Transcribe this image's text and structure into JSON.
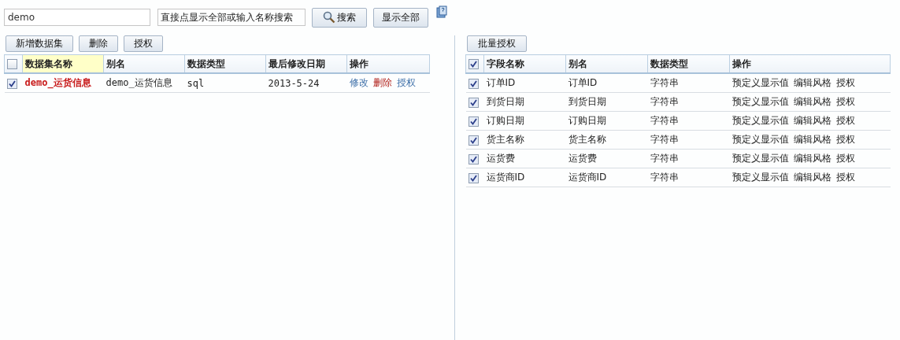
{
  "search": {
    "value": "demo"
  },
  "hint": "直接点显示全部或输入名称搜索",
  "search_button": "搜索",
  "show_all_button": "显示全部",
  "left": {
    "buttons": [
      "新增数据集",
      "删除",
      "授权"
    ],
    "header_checked": false,
    "columns": [
      {
        "label": "数据集名称",
        "highlighted": true
      },
      {
        "label": "别名",
        "highlighted": false
      },
      {
        "label": "数据类型",
        "highlighted": false
      },
      {
        "label": "最后修改日期",
        "highlighted": false
      },
      {
        "label": "操作",
        "highlighted": false
      }
    ],
    "rows": [
      {
        "checked": true,
        "name": "demo_运货信息",
        "alias": "demo_运货信息",
        "type": "sql",
        "date": "2013-5-24",
        "actions": [
          {
            "label": "修改",
            "kind": "link"
          },
          {
            "label": "删除",
            "kind": "danger"
          },
          {
            "label": "授权",
            "kind": "link"
          }
        ]
      }
    ]
  },
  "right": {
    "buttons": [
      "批量授权"
    ],
    "header_checked": true,
    "columns": [
      "字段名称",
      "别名",
      "数据类型",
      "操作"
    ],
    "rows": [
      {
        "checked": true,
        "name": "订单ID",
        "alias": "订单ID",
        "type": "字符串",
        "actions": [
          "预定义显示值",
          "编辑风格",
          "授权"
        ]
      },
      {
        "checked": true,
        "name": "到货日期",
        "alias": "到货日期",
        "type": "字符串",
        "actions": [
          "预定义显示值",
          "编辑风格",
          "授权"
        ]
      },
      {
        "checked": true,
        "name": "订购日期",
        "alias": "订购日期",
        "type": "字符串",
        "actions": [
          "预定义显示值",
          "编辑风格",
          "授权"
        ]
      },
      {
        "checked": true,
        "name": "货主名称",
        "alias": "货主名称",
        "type": "字符串",
        "actions": [
          "预定义显示值",
          "编辑风格",
          "授权"
        ]
      },
      {
        "checked": true,
        "name": "运货费",
        "alias": "运货费",
        "type": "字符串",
        "actions": [
          "预定义显示值",
          "编辑风格",
          "授权"
        ]
      },
      {
        "checked": true,
        "name": "运货商ID",
        "alias": "运货商ID",
        "type": "字符串",
        "actions": [
          "预定义显示值",
          "编辑风格",
          "授权"
        ]
      }
    ]
  }
}
